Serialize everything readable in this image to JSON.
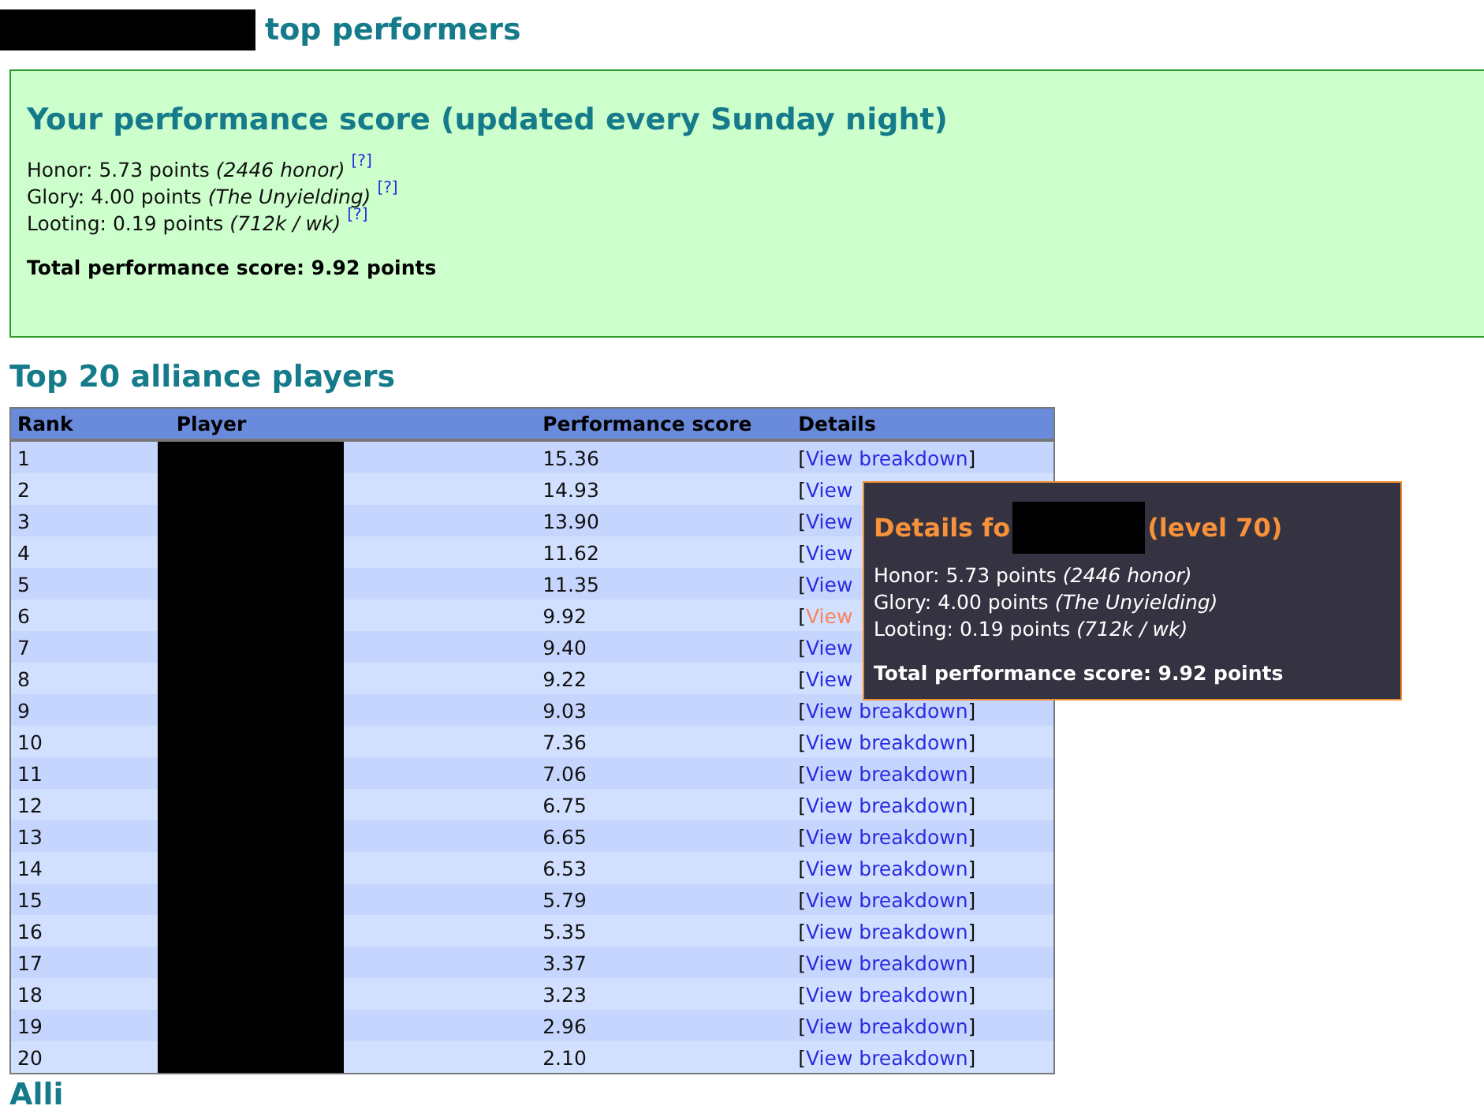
{
  "page_title": "top performers",
  "score_box": {
    "heading": "Your performance score (updated every Sunday night)",
    "lines": [
      {
        "label": "Honor: 5.73 points",
        "note": "(2446 honor)",
        "help": "[?]"
      },
      {
        "label": "Glory: 4.00 points",
        "note": "(The Unyielding)",
        "help": "[?]"
      },
      {
        "label": "Looting: 0.19 points",
        "note": "(712k / wk)",
        "help": "[?]"
      }
    ],
    "total": "Total performance score: 9.92 points"
  },
  "table_heading": "Top 20 alliance players",
  "table": {
    "columns": [
      "Rank",
      "Player",
      "Performance score",
      "Details"
    ],
    "rows": [
      {
        "rank": "1",
        "score": "15.36",
        "open": "[",
        "link": "View breakdown",
        "close": "]",
        "hovered": false
      },
      {
        "rank": "2",
        "score": "14.93",
        "open": "[",
        "link": "View",
        "hovered": false
      },
      {
        "rank": "3",
        "score": "13.90",
        "open": "[",
        "link": "View",
        "hovered": false
      },
      {
        "rank": "4",
        "score": "11.62",
        "open": "[",
        "link": "View",
        "hovered": false
      },
      {
        "rank": "5",
        "score": "11.35",
        "open": "[",
        "link": "View",
        "hovered": false
      },
      {
        "rank": "6",
        "score": "9.92",
        "open": "[",
        "link": "View",
        "hovered": true
      },
      {
        "rank": "7",
        "score": "9.40",
        "open": "[",
        "link": "View",
        "hovered": false
      },
      {
        "rank": "8",
        "score": "9.22",
        "open": "[",
        "link": "View",
        "hovered": false
      },
      {
        "rank": "9",
        "score": "9.03",
        "open": "[",
        "link": "View breakdown",
        "close": "]",
        "hovered": false
      },
      {
        "rank": "10",
        "score": "7.36",
        "open": "[",
        "link": "View breakdown",
        "close": "]",
        "hovered": false
      },
      {
        "rank": "11",
        "score": "7.06",
        "open": "[",
        "link": "View breakdown",
        "close": "]",
        "hovered": false
      },
      {
        "rank": "12",
        "score": "6.75",
        "open": "[",
        "link": "View breakdown",
        "close": "]",
        "hovered": false
      },
      {
        "rank": "13",
        "score": "6.65",
        "open": "[",
        "link": "View breakdown",
        "close": "]",
        "hovered": false
      },
      {
        "rank": "14",
        "score": "6.53",
        "open": "[",
        "link": "View breakdown",
        "close": "]",
        "hovered": false
      },
      {
        "rank": "15",
        "score": "5.79",
        "open": "[",
        "link": "View breakdown",
        "close": "]",
        "hovered": false
      },
      {
        "rank": "16",
        "score": "5.35",
        "open": "[",
        "link": "View breakdown",
        "close": "]",
        "hovered": false
      },
      {
        "rank": "17",
        "score": "3.37",
        "open": "[",
        "link": "View breakdown",
        "close": "]",
        "hovered": false
      },
      {
        "rank": "18",
        "score": "3.23",
        "open": "[",
        "link": "View breakdown",
        "close": "]",
        "hovered": false
      },
      {
        "rank": "19",
        "score": "2.96",
        "open": "[",
        "link": "View breakdown",
        "close": "]",
        "hovered": false
      },
      {
        "rank": "20",
        "score": "2.10",
        "open": "[",
        "link": "View breakdown",
        "close": "]",
        "hovered": false
      }
    ]
  },
  "tooltip": {
    "title_start": "Details fo",
    "title_end": "(level 70)",
    "lines": [
      {
        "label": "Honor: 5.73 points",
        "note": "(2446 honor)"
      },
      {
        "label": "Glory: 4.00 points",
        "note": "(The Unyielding)"
      },
      {
        "label": "Looting: 0.19 points",
        "note": "(712k / wk)"
      }
    ],
    "total": "Total performance score: 9.92 points"
  },
  "next_heading": "Alli"
}
